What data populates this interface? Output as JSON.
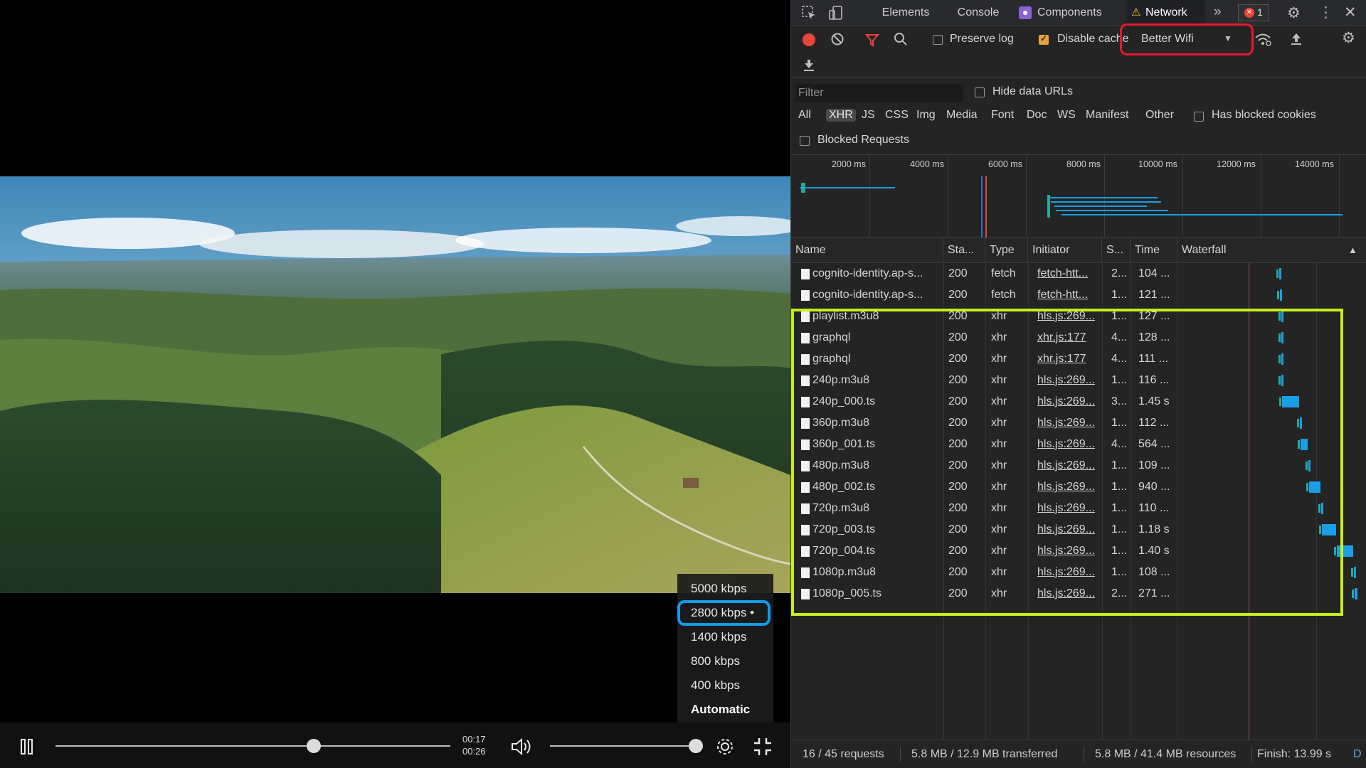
{
  "player": {
    "quality_options": [
      "5000 kbps",
      "2800 kbps •",
      "1400 kbps",
      "800 kbps",
      "400 kbps",
      "Automatic"
    ],
    "current_time": "00:17",
    "duration": "00:26",
    "seek_progress": 0.654,
    "volume_level": 1.0
  },
  "devtools": {
    "tabs": {
      "elements": "Elements",
      "console": "Console",
      "components": "Components",
      "network": "Network"
    },
    "error_badge": "1",
    "toolbar": {
      "preserve_log": "Preserve log",
      "disable_cache": "Disable cache",
      "throttle_value": "Better Wifi"
    },
    "filter": {
      "placeholder": "Filter",
      "hide_data_urls": "Hide data URLs",
      "types": [
        "All",
        "XHR",
        "JS",
        "CSS",
        "Img",
        "Media",
        "Font",
        "Doc",
        "WS",
        "Manifest",
        "Other"
      ],
      "active_type": "XHR",
      "has_blocked_cookies": "Has blocked cookies",
      "blocked_requests": "Blocked Requests"
    },
    "overview_ticks": [
      "2000 ms",
      "4000 ms",
      "6000 ms",
      "8000 ms",
      "10000 ms",
      "12000 ms",
      "14000 ms"
    ],
    "columns": {
      "name": "Name",
      "status": "Sta...",
      "type": "Type",
      "initiator": "Initiator",
      "size": "S...",
      "time": "Time",
      "waterfall": "Waterfall"
    },
    "rows": [
      {
        "name": "cognito-identity.ap-s...",
        "status": "200",
        "type": "fetch",
        "initiator": "fetch-htt...",
        "size": "2...",
        "time": "104 ...",
        "wf_start": 0.536,
        "wf_len": 0.004
      },
      {
        "name": "cognito-identity.ap-s...",
        "status": "200",
        "type": "fetch",
        "initiator": "fetch-htt...",
        "size": "1...",
        "time": "121 ...",
        "wf_start": 0.54,
        "wf_len": 0.004
      },
      {
        "name": "playlist.m3u8",
        "status": "200",
        "type": "xhr",
        "initiator": "hls.js:269...",
        "size": "1...",
        "time": "127 ...",
        "wf_start": 0.548,
        "wf_len": 0.004
      },
      {
        "name": "graphql",
        "status": "200",
        "type": "xhr",
        "initiator": "xhr.js:177",
        "size": "4...",
        "time": "128 ...",
        "wf_start": 0.55,
        "wf_len": 0.004
      },
      {
        "name": "graphql",
        "status": "200",
        "type": "xhr",
        "initiator": "xhr.js:177",
        "size": "4...",
        "time": "111 ...",
        "wf_start": 0.55,
        "wf_len": 0.004
      },
      {
        "name": "240p.m3u8",
        "status": "200",
        "type": "xhr",
        "initiator": "hls.js:269...",
        "size": "1...",
        "time": "116 ...",
        "wf_start": 0.55,
        "wf_len": 0.004
      },
      {
        "name": "240p_000.ts",
        "status": "200",
        "type": "xhr",
        "initiator": "hls.js:269...",
        "size": "3...",
        "time": "1.45 s",
        "wf_start": 0.554,
        "wf_len": 0.09
      },
      {
        "name": "360p.m3u8",
        "status": "200",
        "type": "xhr",
        "initiator": "hls.js:269...",
        "size": "1...",
        "time": "112 ...",
        "wf_start": 0.648,
        "wf_len": 0.004
      },
      {
        "name": "360p_001.ts",
        "status": "200",
        "type": "xhr",
        "initiator": "hls.js:269...",
        "size": "4...",
        "time": "564 ...",
        "wf_start": 0.652,
        "wf_len": 0.035
      },
      {
        "name": "480p.m3u8",
        "status": "200",
        "type": "xhr",
        "initiator": "hls.js:269...",
        "size": "1...",
        "time": "109 ...",
        "wf_start": 0.69,
        "wf_len": 0.004
      },
      {
        "name": "480p_002.ts",
        "status": "200",
        "type": "xhr",
        "initiator": "hls.js:269...",
        "size": "1...",
        "time": "940 ...",
        "wf_start": 0.694,
        "wf_len": 0.06
      },
      {
        "name": "720p.m3u8",
        "status": "200",
        "type": "xhr",
        "initiator": "hls.js:269...",
        "size": "1...",
        "time": "110 ...",
        "wf_start": 0.758,
        "wf_len": 0.004
      },
      {
        "name": "720p_003.ts",
        "status": "200",
        "type": "xhr",
        "initiator": "hls.js:269...",
        "size": "1...",
        "time": "1.18 s",
        "wf_start": 0.764,
        "wf_len": 0.075
      },
      {
        "name": "720p_004.ts",
        "status": "200",
        "type": "xhr",
        "initiator": "hls.js:269...",
        "size": "1...",
        "time": "1.40 s",
        "wf_start": 0.842,
        "wf_len": 0.088
      },
      {
        "name": "1080p.m3u8",
        "status": "200",
        "type": "xhr",
        "initiator": "hls.js:269...",
        "size": "1...",
        "time": "108 ...",
        "wf_start": 0.932,
        "wf_len": 0.004
      },
      {
        "name": "1080p_005.ts",
        "status": "200",
        "type": "xhr",
        "initiator": "hls.js:269...",
        "size": "2...",
        "time": "271 ...",
        "wf_start": 0.936,
        "wf_len": 0.017
      }
    ],
    "status": {
      "requests": "16 / 45 requests",
      "transferred": "5.8 MB / 12.9 MB transferred",
      "resources": "5.8 MB / 41.4 MB resources",
      "finish": "Finish: 13.99 s",
      "dom": "D"
    }
  },
  "colors": {
    "highlight_red": "#e31b2d",
    "highlight_green": "#c7f01a",
    "highlight_blue": "#119be8",
    "record_red": "#e8453c"
  }
}
